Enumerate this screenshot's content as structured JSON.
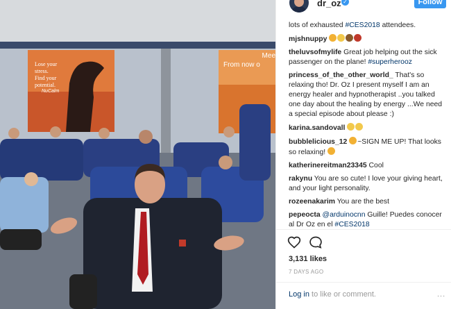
{
  "header": {
    "username": "dr_oz",
    "follow_label": "Follow"
  },
  "comments": [
    {
      "user": "",
      "text": "lots of exhausted ",
      "tag": "#CES2018",
      "text2": " attendees."
    },
    {
      "user": "mjshnuppy",
      "text": "",
      "tag": "",
      "text2": "",
      "emojis": [
        "#f2b134",
        "#f2c94c",
        "#8a5a2b",
        "#c0392b"
      ]
    },
    {
      "user": "theluvsofmylife",
      "text": "Great job helping out the sick passenger on the plane! ",
      "tag": "#superherooz",
      "text2": ""
    },
    {
      "user": "princess_of_the_other_world_",
      "text": "That's so relaxing tho! Dr. Oz I present myself I am an energy healer and hypnotherapist ..you talked one day about the healing by energy ...We need a special episode about please :)",
      "tag": "",
      "text2": ""
    },
    {
      "user": "karina.sandovall",
      "text": "",
      "tag": "",
      "text2": "",
      "emojis": [
        "#f2c94c",
        "#f2c94c"
      ]
    },
    {
      "user": "bubblelicious_12",
      "text": "~SIGN ME UP! That looks so relaxing! ",
      "tag": "",
      "text2": "",
      "emojis": [
        "#f2b134"
      ]
    },
    {
      "user": "katherinereitman23345",
      "text": "Cool",
      "tag": "",
      "text2": ""
    },
    {
      "user": "rakynu",
      "text": "You are so cute! I love your giving heart, and your light personality.",
      "tag": "",
      "text2": ""
    },
    {
      "user": "rozeenakarim",
      "text": "You are the best",
      "tag": "",
      "text2": ""
    },
    {
      "user": "pepeocta",
      "text": "",
      "tag": "@arduinocnn",
      "text2": " Guille! Puedes conocer al Dr Oz en el ",
      "tag2": "#CES2018"
    }
  ],
  "post": {
    "likes": "3,131 likes",
    "time_ago": "7 DAYS AGO"
  },
  "footer": {
    "login_link": "Log in",
    "login_text": " to like or comment.",
    "more": "..."
  },
  "photo": {
    "banner_left": [
      "Lose your",
      "stress.",
      "Find your",
      "potential."
    ],
    "banner_left_brand": "NuCalm",
    "banner_right": [
      "Mee",
      "From now o"
    ]
  }
}
